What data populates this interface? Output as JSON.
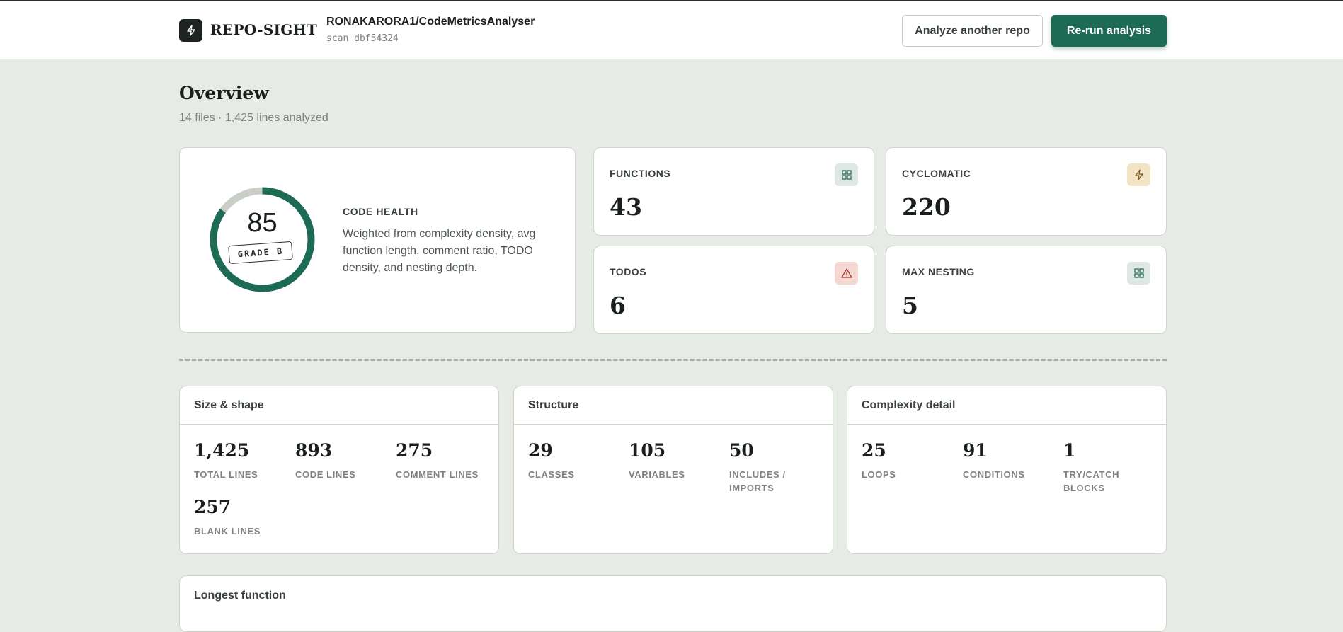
{
  "header": {
    "brand": "REPO-SIGHT",
    "repo": "RONAKARORA1/CodeMetricsAnalyser",
    "scan": "scan dbf54324",
    "analyze_label": "Analyze another repo",
    "rerun_label": "Re-run analysis"
  },
  "overview": {
    "title": "Overview",
    "subtitle": "14 files · 1,425 lines analyzed"
  },
  "health": {
    "score": "85",
    "score_fraction": 0.85,
    "grade": "GRADE B",
    "label": "CODE HEALTH",
    "description": "Weighted from complexity density, avg function length, comment ratio, TODO density, and nesting depth."
  },
  "stats": {
    "functions": {
      "label": "FUNCTIONS",
      "value": "43",
      "icon": "grid-icon"
    },
    "cyclomatic": {
      "label": "CYCLOMATIC",
      "value": "220",
      "icon": "lightning-icon"
    },
    "todos": {
      "label": "TODOS",
      "value": "6",
      "icon": "warning-icon"
    },
    "max_nesting": {
      "label": "MAX NESTING",
      "value": "5",
      "icon": "grid-icon"
    }
  },
  "panels": {
    "size": {
      "title": "Size & shape",
      "metrics": [
        {
          "value": "1,425",
          "label": "TOTAL LINES"
        },
        {
          "value": "893",
          "label": "CODE LINES"
        },
        {
          "value": "275",
          "label": "COMMENT LINES"
        },
        {
          "value": "257",
          "label": "BLANK LINES"
        }
      ]
    },
    "structure": {
      "title": "Structure",
      "metrics": [
        {
          "value": "29",
          "label": "CLASSES"
        },
        {
          "value": "105",
          "label": "VARIABLES"
        },
        {
          "value": "50",
          "label": "INCLUDES / IMPORTS"
        }
      ]
    },
    "complexity": {
      "title": "Complexity detail",
      "metrics": [
        {
          "value": "25",
          "label": "LOOPS"
        },
        {
          "value": "91",
          "label": "CONDITIONS"
        },
        {
          "value": "1",
          "label": "TRY/CATCH BLOCKS"
        }
      ]
    }
  },
  "longest": {
    "title": "Longest function"
  },
  "colors": {
    "accent": "#1e6b55",
    "background": "#e7ebe5",
    "gauge_track": "#c9cec7"
  }
}
